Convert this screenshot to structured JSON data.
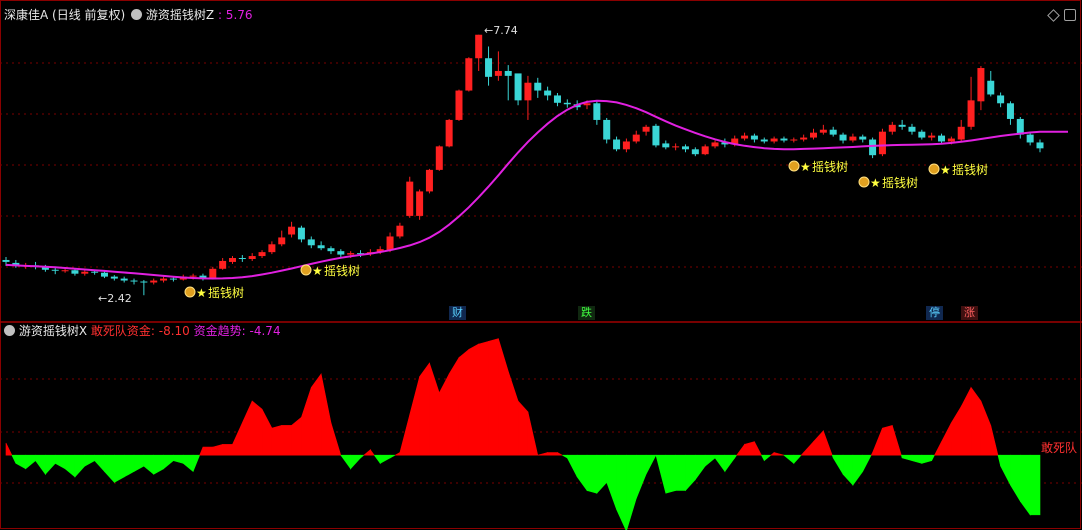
{
  "header_top": {
    "stock": "深康佳A",
    "period": "(日线 前复权)",
    "indicator": "游资摇钱树Z",
    "value": ": 5.76"
  },
  "header_bottom": {
    "indicator": "游资摇钱树X",
    "s1_label": "敢死队资金:",
    "s1_value": "-8.10",
    "s2_label": "资金趋势:",
    "s2_value": "-4.74"
  },
  "right_label": "敢死队",
  "high_label": "7.74",
  "low_label": "2.42",
  "signal_text": "摇钱树",
  "markers": [
    "财",
    "跌",
    "停",
    "涨"
  ],
  "colors": {
    "up": "#ff2020",
    "down": "#3ad6d6",
    "ma": "#e020e0",
    "grid": "#7a0000",
    "signal": "#ffff40",
    "green": "#00ff00",
    "red": "#ff0000"
  },
  "chart_data": [
    {
      "type": "candlestick",
      "title": "游资摇钱树Z",
      "ylim": [
        2.2,
        8.0
      ],
      "candles": [
        [
          3.14,
          3.1,
          3.2,
          3.02
        ],
        [
          3.08,
          3.02,
          3.14,
          2.98
        ],
        [
          3.02,
          3.03,
          3.08,
          2.96
        ],
        [
          3.03,
          3.0,
          3.1,
          2.95
        ],
        [
          3.0,
          2.94,
          3.04,
          2.9
        ],
        [
          2.94,
          2.92,
          2.98,
          2.85
        ],
        [
          2.92,
          2.93,
          2.96,
          2.88
        ],
        [
          2.93,
          2.86,
          2.96,
          2.82
        ],
        [
          2.86,
          2.9,
          2.94,
          2.82
        ],
        [
          2.9,
          2.88,
          2.94,
          2.84
        ],
        [
          2.88,
          2.8,
          2.92,
          2.77
        ],
        [
          2.8,
          2.76,
          2.83,
          2.72
        ],
        [
          2.76,
          2.72,
          2.8,
          2.68
        ],
        [
          2.72,
          2.7,
          2.76,
          2.64
        ],
        [
          2.7,
          2.68,
          2.73,
          2.42
        ],
        [
          2.68,
          2.72,
          2.76,
          2.64
        ],
        [
          2.72,
          2.76,
          2.8,
          2.68
        ],
        [
          2.76,
          2.74,
          2.79,
          2.7
        ],
        [
          2.74,
          2.8,
          2.84,
          2.72
        ],
        [
          2.8,
          2.82,
          2.86,
          2.74
        ],
        [
          2.82,
          2.76,
          2.86,
          2.72
        ],
        [
          2.76,
          2.96,
          3.0,
          2.74
        ],
        [
          2.96,
          3.12,
          3.18,
          2.94
        ],
        [
          3.1,
          3.18,
          3.22,
          3.06
        ],
        [
          3.18,
          3.16,
          3.24,
          3.1
        ],
        [
          3.16,
          3.22,
          3.28,
          3.12
        ],
        [
          3.22,
          3.3,
          3.34,
          3.18
        ],
        [
          3.3,
          3.46,
          3.52,
          3.26
        ],
        [
          3.46,
          3.6,
          3.74,
          3.42
        ],
        [
          3.66,
          3.82,
          3.92,
          3.6
        ],
        [
          3.8,
          3.56,
          3.84,
          3.5
        ],
        [
          3.56,
          3.44,
          3.62,
          3.38
        ],
        [
          3.44,
          3.38,
          3.52,
          3.34
        ],
        [
          3.38,
          3.32,
          3.42,
          3.26
        ],
        [
          3.32,
          3.25,
          3.36,
          3.2
        ],
        [
          3.25,
          3.28,
          3.32,
          3.18
        ],
        [
          3.28,
          3.26,
          3.34,
          3.2
        ],
        [
          3.26,
          3.3,
          3.36,
          3.22
        ],
        [
          3.3,
          3.36,
          3.42,
          3.26
        ],
        [
          3.34,
          3.62,
          3.7,
          3.3
        ],
        [
          3.62,
          3.84,
          3.9,
          3.58
        ],
        [
          4.04,
          4.74,
          4.84,
          4.0
        ],
        [
          4.04,
          4.54,
          4.58,
          3.96
        ],
        [
          4.54,
          4.98,
          5.0,
          4.5
        ],
        [
          4.98,
          5.46,
          5.48,
          4.96
        ],
        [
          5.46,
          6.0,
          6.02,
          5.44
        ],
        [
          6.0,
          6.6,
          6.62,
          5.98
        ],
        [
          6.6,
          7.26,
          7.28,
          6.58
        ],
        [
          7.26,
          7.74,
          7.74,
          7.0
        ],
        [
          7.26,
          6.88,
          7.5,
          6.7
        ],
        [
          6.9,
          7.0,
          7.4,
          6.8
        ],
        [
          7.0,
          6.9,
          7.12,
          6.4
        ],
        [
          6.95,
          6.4,
          6.8,
          6.3
        ],
        [
          6.4,
          6.76,
          6.9,
          6.0
        ],
        [
          6.76,
          6.6,
          6.86,
          6.45
        ],
        [
          6.6,
          6.5,
          6.68,
          6.4
        ],
        [
          6.5,
          6.35,
          6.55,
          6.28
        ],
        [
          6.35,
          6.32,
          6.42,
          6.25
        ],
        [
          6.32,
          6.26,
          6.4,
          6.2
        ],
        [
          6.3,
          6.34,
          6.4,
          6.22
        ],
        [
          6.34,
          6.0,
          6.38,
          5.9
        ],
        [
          6.0,
          5.6,
          6.04,
          5.52
        ],
        [
          5.6,
          5.4,
          5.66,
          5.36
        ],
        [
          5.4,
          5.56,
          5.62,
          5.34
        ],
        [
          5.56,
          5.7,
          5.78,
          5.52
        ],
        [
          5.76,
          5.86,
          5.9,
          5.68
        ],
        [
          5.88,
          5.48,
          5.92,
          5.44
        ],
        [
          5.52,
          5.44,
          5.58,
          5.4
        ],
        [
          5.44,
          5.46,
          5.52,
          5.38
        ],
        [
          5.46,
          5.4,
          5.5,
          5.34
        ],
        [
          5.4,
          5.3,
          5.44,
          5.26
        ],
        [
          5.3,
          5.46,
          5.5,
          5.28
        ],
        [
          5.46,
          5.54,
          5.58,
          5.42
        ],
        [
          5.54,
          5.5,
          5.62,
          5.44
        ],
        [
          5.5,
          5.62,
          5.68,
          5.46
        ],
        [
          5.62,
          5.68,
          5.74,
          5.58
        ],
        [
          5.68,
          5.6,
          5.72,
          5.54
        ],
        [
          5.6,
          5.56,
          5.64,
          5.52
        ],
        [
          5.56,
          5.62,
          5.66,
          5.52
        ],
        [
          5.62,
          5.58,
          5.66,
          5.54
        ],
        [
          5.58,
          5.6,
          5.64,
          5.54
        ],
        [
          5.6,
          5.64,
          5.7,
          5.56
        ],
        [
          5.64,
          5.74,
          5.82,
          5.6
        ],
        [
          5.74,
          5.8,
          5.9,
          5.7
        ],
        [
          5.8,
          5.7,
          5.86,
          5.66
        ],
        [
          5.7,
          5.58,
          5.74,
          5.52
        ],
        [
          5.58,
          5.66,
          5.72,
          5.54
        ],
        [
          5.66,
          5.6,
          5.7,
          5.54
        ],
        [
          5.6,
          5.28,
          5.64,
          5.22
        ],
        [
          5.3,
          5.76,
          5.82,
          5.26
        ],
        [
          5.76,
          5.9,
          5.96,
          5.7
        ],
        [
          5.9,
          5.86,
          6.0,
          5.8
        ],
        [
          5.86,
          5.76,
          5.92,
          5.7
        ],
        [
          5.76,
          5.64,
          5.8,
          5.6
        ],
        [
          5.64,
          5.68,
          5.74,
          5.58
        ],
        [
          5.68,
          5.56,
          5.72,
          5.52
        ],
        [
          5.56,
          5.62,
          5.66,
          5.5
        ],
        [
          5.6,
          5.86,
          6.0,
          5.54
        ],
        [
          5.86,
          6.4,
          6.88,
          5.8
        ],
        [
          6.38,
          7.06,
          7.1,
          6.2
        ],
        [
          6.8,
          6.52,
          7.0,
          6.48
        ],
        [
          6.5,
          6.34,
          6.56,
          6.26
        ],
        [
          6.34,
          6.02,
          6.38,
          5.9
        ],
        [
          6.02,
          5.7,
          6.06,
          5.62
        ],
        [
          5.7,
          5.54,
          5.76,
          5.48
        ],
        [
          5.54,
          5.42,
          5.6,
          5.34
        ]
      ],
      "ma_endpoints": [
        3.04,
        5.76
      ]
    },
    {
      "type": "bar",
      "title": "游资摇钱树X",
      "series": [
        {
          "name": "敢死队资金"
        },
        {
          "name": "资金趋势"
        }
      ],
      "ylim": [
        -50,
        85
      ],
      "values": [
        9,
        -6,
        -10,
        -4,
        -14,
        -6,
        -10,
        -16,
        -8,
        -4,
        -12,
        -20,
        -16,
        -12,
        -8,
        -14,
        -10,
        -4,
        -6,
        -12,
        6,
        6,
        8,
        8,
        24,
        40,
        34,
        20,
        22,
        22,
        28,
        50,
        60,
        24,
        0,
        -10,
        -2,
        4,
        -6,
        -2,
        2,
        30,
        58,
        68,
        46,
        60,
        72,
        78,
        82,
        84,
        86,
        62,
        40,
        32,
        0,
        2,
        2,
        -2,
        -16,
        -26,
        -28,
        -20,
        -40,
        -56,
        -32,
        -14,
        0,
        -28,
        -26,
        -26,
        -18,
        -8,
        -2,
        -12,
        -2,
        8,
        10,
        -4,
        2,
        0,
        -6,
        2,
        10,
        18,
        -2,
        -14,
        -22,
        -12,
        2,
        20,
        22,
        -2,
        -4,
        -6,
        -4,
        10,
        24,
        36,
        50,
        40,
        22,
        -8,
        -22,
        -34,
        -44,
        -44
      ]
    }
  ]
}
